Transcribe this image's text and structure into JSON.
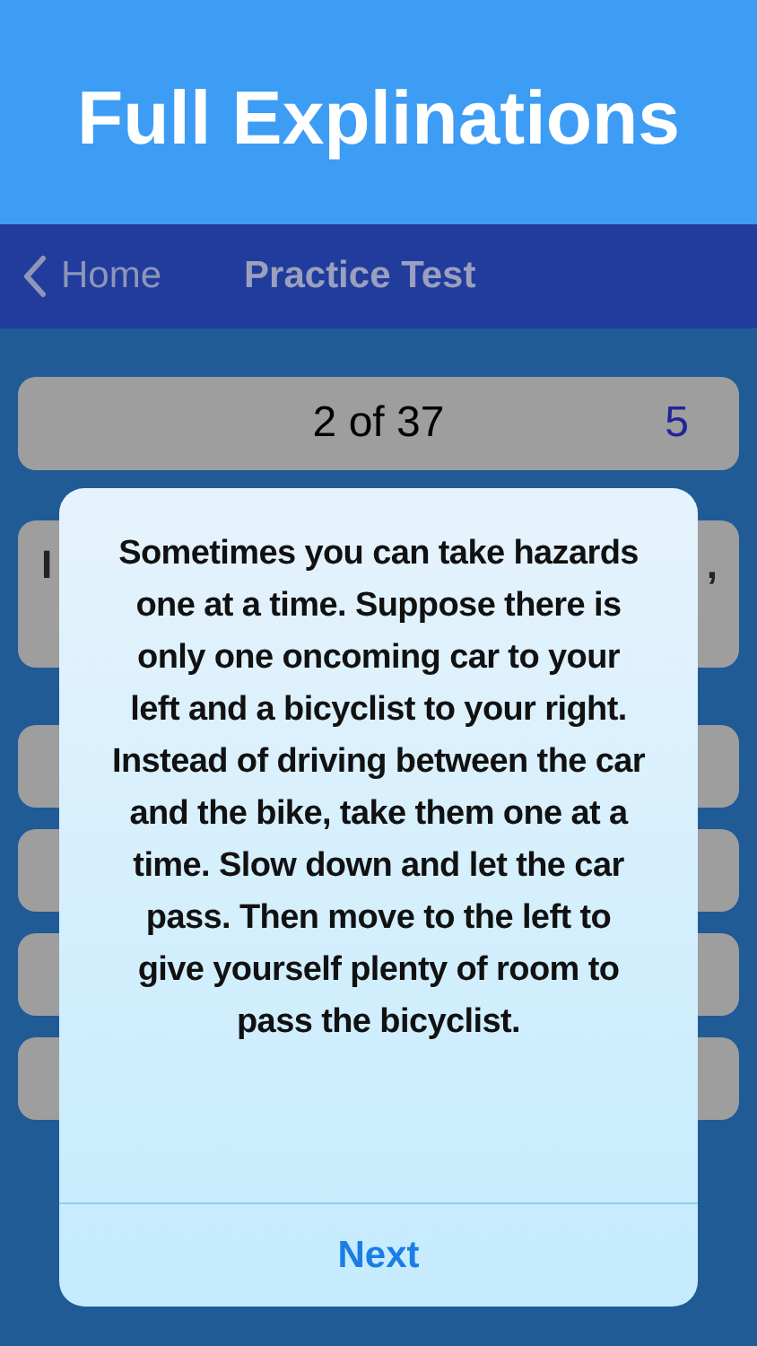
{
  "banner": {
    "title": "Full Explinations"
  },
  "nav_bar": {
    "back_label": "Home",
    "title": "Practice Test"
  },
  "progress": {
    "position": "2 of 37",
    "score": "5"
  },
  "question": {
    "visible_start": "I",
    "visible_end": ","
  },
  "explanation_dialog": {
    "text": "Sometimes you can take hazards one at a time. Suppose there is only one oncoming car to your left and a bicyclist to your right. Instead of driving between the car and the bike, take them one at a time. Slow down and let the car pass. Then move to the left to give yourself plenty of room to pass the bicyclist.",
    "button": "Next"
  }
}
